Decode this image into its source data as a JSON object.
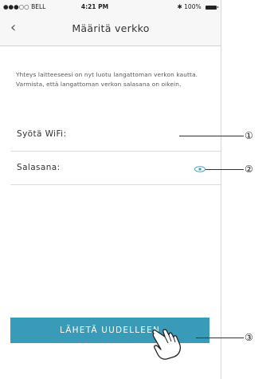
{
  "status_bar": {
    "carrier": "●●●○○ BELL",
    "time": "4:21 PM",
    "battery_text": "100%"
  },
  "nav": {
    "back_icon": "chevron-left-icon",
    "title": "Määritä verkko"
  },
  "intro_text": "Yhteys laitteeseesi on nyt luotu langattoman verkon kautta. Varmista, että langattoman verkon salasana on oikein.",
  "fields": {
    "wifi_label": "Syötä WiFi:",
    "password_label": "Salasana:"
  },
  "button": {
    "label": "LÄHETÄ UUDELLEEN"
  },
  "callouts": [
    "①",
    "②",
    "③"
  ],
  "colors": {
    "accent": "#3a9bb8",
    "bar_bg": "#f7f7f7"
  }
}
